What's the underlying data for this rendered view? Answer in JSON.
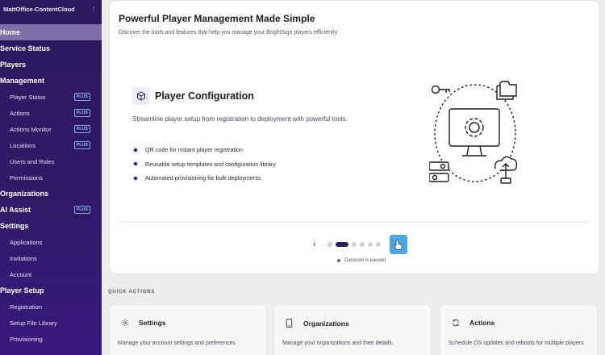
{
  "sidebar": {
    "org_name": "MattOffice-ContentCloud",
    "plus_label": "PLUS",
    "items": [
      {
        "label": "Home",
        "level": "top",
        "active": true,
        "plus": false
      },
      {
        "label": "Service Status",
        "level": "top",
        "active": false,
        "plus": false
      },
      {
        "label": "Players",
        "level": "top",
        "active": false,
        "plus": false
      },
      {
        "label": "Management",
        "level": "top",
        "active": false,
        "plus": false
      },
      {
        "label": "Player Status",
        "level": "sub",
        "active": false,
        "plus": true
      },
      {
        "label": "Actions",
        "level": "sub",
        "active": false,
        "plus": true
      },
      {
        "label": "Actions Monitor",
        "level": "sub",
        "active": false,
        "plus": true
      },
      {
        "label": "Locations",
        "level": "sub",
        "active": false,
        "plus": true
      },
      {
        "label": "Users and Roles",
        "level": "sub",
        "active": false,
        "plus": false
      },
      {
        "label": "Permissions",
        "level": "sub",
        "active": false,
        "plus": false
      },
      {
        "label": "Organizations",
        "level": "top",
        "active": false,
        "plus": false
      },
      {
        "label": "AI Assist",
        "level": "top",
        "active": false,
        "plus": true
      },
      {
        "label": "Settings",
        "level": "top",
        "active": false,
        "plus": false
      },
      {
        "label": "Applications",
        "level": "sub",
        "active": false,
        "plus": false
      },
      {
        "label": "Invitations",
        "level": "sub",
        "active": false,
        "plus": false
      },
      {
        "label": "Account",
        "level": "sub",
        "active": false,
        "plus": false
      },
      {
        "label": "Player Setup",
        "level": "top",
        "active": false,
        "plus": false
      },
      {
        "label": "Registration",
        "level": "sub",
        "active": false,
        "plus": false
      },
      {
        "label": "Setup File Library",
        "level": "sub",
        "active": false,
        "plus": false
      },
      {
        "label": "Provisioning",
        "level": "sub",
        "active": false,
        "plus": false
      }
    ]
  },
  "hero": {
    "title": "Powerful Player Management Made Simple",
    "subtitle": "Discover the tools and features that help you manage your BrightSign players efficiently",
    "slide": {
      "icon": "cube-icon",
      "title": "Player Configuration",
      "description": "Streamline player setup from registration to deployment with powerful tools",
      "features": [
        "QR code for instant player registration",
        "Reusable setup templates and configuration library",
        "Automated provisioning for bulk deployments"
      ]
    },
    "carousel": {
      "dot_count": 6,
      "active_index": 1,
      "status": "Carousel is paused"
    }
  },
  "quick_actions": {
    "heading": "QUICK ACTIONS",
    "cards": [
      {
        "icon": "gear-icon",
        "title": "Settings",
        "description": "Manage your account settings and preferences"
      },
      {
        "icon": "phone-icon",
        "title": "Organizations",
        "description": "Manage your organizations and their details."
      },
      {
        "icon": "refresh-icon",
        "title": "Actions",
        "description": "Schedule OS updates and reboots for multiple players"
      }
    ]
  },
  "colors": {
    "sidebar_bg": "#2f1a66",
    "active_nav": "#7c6fa8",
    "accent_blue": "#4aa8e6",
    "accent_dark": "#2b1f5c"
  }
}
